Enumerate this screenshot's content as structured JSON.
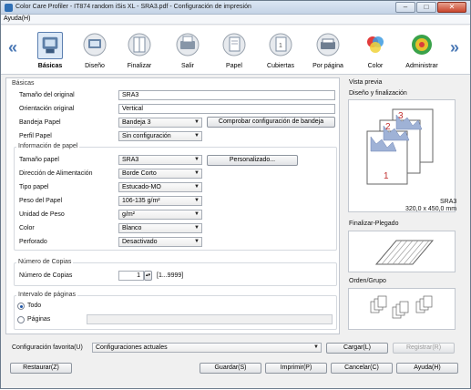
{
  "window": {
    "title": "Color Care Profiler - IT874 random iSis XL - SRA3.pdf - Configuración de impresión",
    "min": "–",
    "max": "□",
    "close": "✕"
  },
  "menu": {
    "help": "Ayuda(H)"
  },
  "tabs": [
    {
      "label": "Básicas",
      "icon": "basic-icon"
    },
    {
      "label": "Diseño",
      "icon": "layout-icon"
    },
    {
      "label": "Finalizar",
      "icon": "finish-icon"
    },
    {
      "label": "Salir",
      "icon": "output-icon"
    },
    {
      "label": "Papel",
      "icon": "paper-icon"
    },
    {
      "label": "Cubiertas",
      "icon": "covers-icon"
    },
    {
      "label": "Por página",
      "icon": "per-page-icon"
    },
    {
      "label": "Color",
      "icon": "color-icon"
    },
    {
      "label": "Administrar",
      "icon": "admin-icon"
    }
  ],
  "nav": {
    "prev": "«",
    "next": "»"
  },
  "basicas": {
    "group": "Básicas",
    "orig_size_label": "Tamaño del original",
    "orig_size": "SRA3",
    "orient_label": "Orientación original",
    "orient": "Vertical",
    "tray_label": "Bandeja Papel",
    "tray": "Bandeja 3",
    "check_tray": "Comprobar configuración de bandeja",
    "profile_label": "Perfil Papel",
    "profile": "Sin configuración"
  },
  "paper_info": {
    "group": "Información de papel",
    "size_label": "Tamaño papel",
    "size": "SRA3",
    "custom": "Personalizado...",
    "feed_label": "Dirección de Alimentación",
    "feed": "Borde Corto",
    "type_label": "Tipo papel",
    "type": "Estucado-MO",
    "weight_label": "Peso del Papel",
    "weight": "106-135 g/m²",
    "unit_label": "Unidad de Peso",
    "unit": "g/m²",
    "color_label": "Color",
    "color": "Blanco",
    "punch_label": "Perforado",
    "punch": "Desactivado"
  },
  "copies": {
    "group": "Número de Copias",
    "label": "Número de Copias",
    "value": "1",
    "range": "[1...9999]"
  },
  "pages": {
    "group": "Intervalo de páginas",
    "all": "Todo",
    "pages": "Páginas"
  },
  "preview": {
    "title": "Vista previa",
    "design": "Diseño y finalización",
    "size_name": "SRA3",
    "size_dims": "320,0 x 450,0 mm",
    "fold": "Finalizar-Plegado",
    "order": "Orden/Grupo",
    "page_nums": [
      "1",
      "2",
      "3"
    ]
  },
  "bottom": {
    "fav_label": "Configuración favorita(U)",
    "fav_value": "Configuraciones actuales",
    "load": "Cargar(L)",
    "register": "Registrar(R)",
    "restore": "Restaurar(Z)",
    "save": "Guardar(S)",
    "print": "Imprimir(P)",
    "cancel": "Cancelar(C)",
    "help": "Ayuda(H)"
  }
}
